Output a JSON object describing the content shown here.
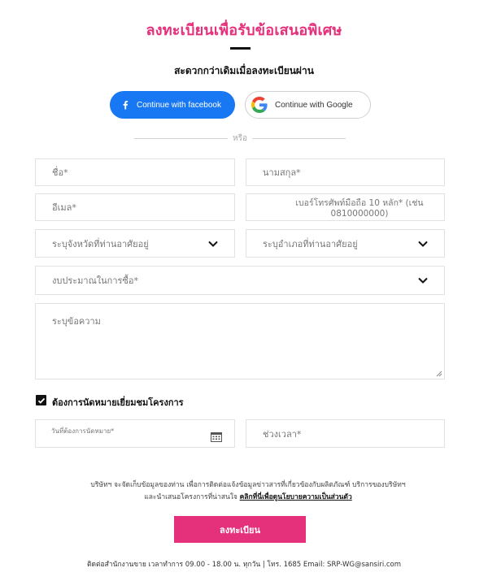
{
  "header": {
    "title": "ลงทะเบียนเพื่อรับข้อเสนอพิเศษ",
    "subtitle": "สะดวกกว่าเดิมเมื่อลงทะเบียนผ่าน"
  },
  "social": {
    "facebook_label": "Continue with facebook",
    "google_label": "Continue with Google",
    "or_text": "หรือ"
  },
  "form": {
    "first_name_placeholder": "ชื่อ*",
    "last_name_placeholder": "นามสกุล*",
    "email_placeholder": "อีเมล*",
    "phone_placeholder": "เบอร์โทรศัพท์มือถือ 10 หลัก* (เช่น 0810000000)",
    "province_placeholder": "ระบุจังหวัดที่ท่านอาศัยอยู่",
    "district_placeholder": "ระบุอำเภอที่ท่านอาศัยอยู่",
    "budget_placeholder": "งบประมาณในการซื้อ*",
    "message_placeholder": "ระบุข้อความ",
    "appointment_checkbox_label": "ต้องการนัดหมายเยี่ยมชมโครงการ",
    "appointment_checked": true,
    "date_placeholder": "วันที่ต้องการนัดหมาย*",
    "time_placeholder": "ช่วงเวลา*"
  },
  "consent": {
    "line1": "บริษัทฯ จะจัดเก็บข้อมูลของท่าน เพื่อการติดต่อแจ้งข้อมูลข่าวสารที่เกี่ยวข้องกับผลิตภัณฑ์ บริการของบริษัทฯ",
    "line2_prefix": "และนำเสนอโครงการที่น่าสนใจ",
    "privacy_link": "คลิกที่นี่เพื่อดูนโยบายความเป็นส่วนตัว"
  },
  "submit_label": "ลงทะเบียน",
  "footer_text": "ติดต่อสำนักงานขาย เวลาทำการ 09.00 - 18.00 น. ทุกวัน | โทร. 1685 Email: SRP-WG@sansiri.com",
  "colors": {
    "accent": "#e5317c",
    "facebook": "#1877f2"
  }
}
